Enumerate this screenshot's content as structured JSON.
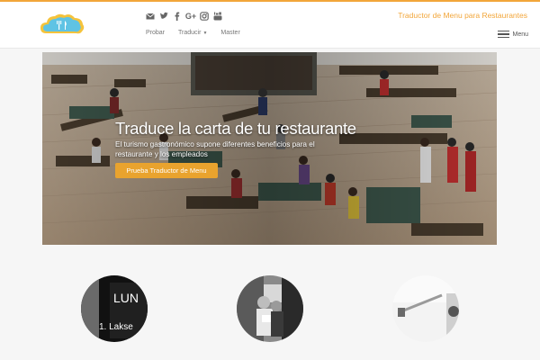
{
  "header": {
    "tagline": "Traductor de Menu para Restaurantes",
    "social_icons": [
      "email-icon",
      "twitter-icon",
      "facebook-icon",
      "google-plus-icon",
      "instagram-icon",
      "youtube-icon"
    ],
    "google_plus_label": "G+",
    "nav": {
      "probar": "Probar",
      "traducir": "Traducir",
      "master": "Master"
    },
    "menu_label": "Menu"
  },
  "hero": {
    "title": "Traduce la carta de tu restaurante",
    "subtitle": "El turismo gastronómico supone diferentes beneficios para el restaurante y los empleados",
    "button_label": "Prueba Traductor de Menu"
  },
  "features": {
    "circle1_text_line1": "LUN",
    "circle1_text_line2": "1. Lakse"
  },
  "colors": {
    "accent": "#f2a63a",
    "button": "#e9a32e",
    "logo_blue": "#5fc3e4",
    "logo_yellow": "#f5c33b"
  }
}
